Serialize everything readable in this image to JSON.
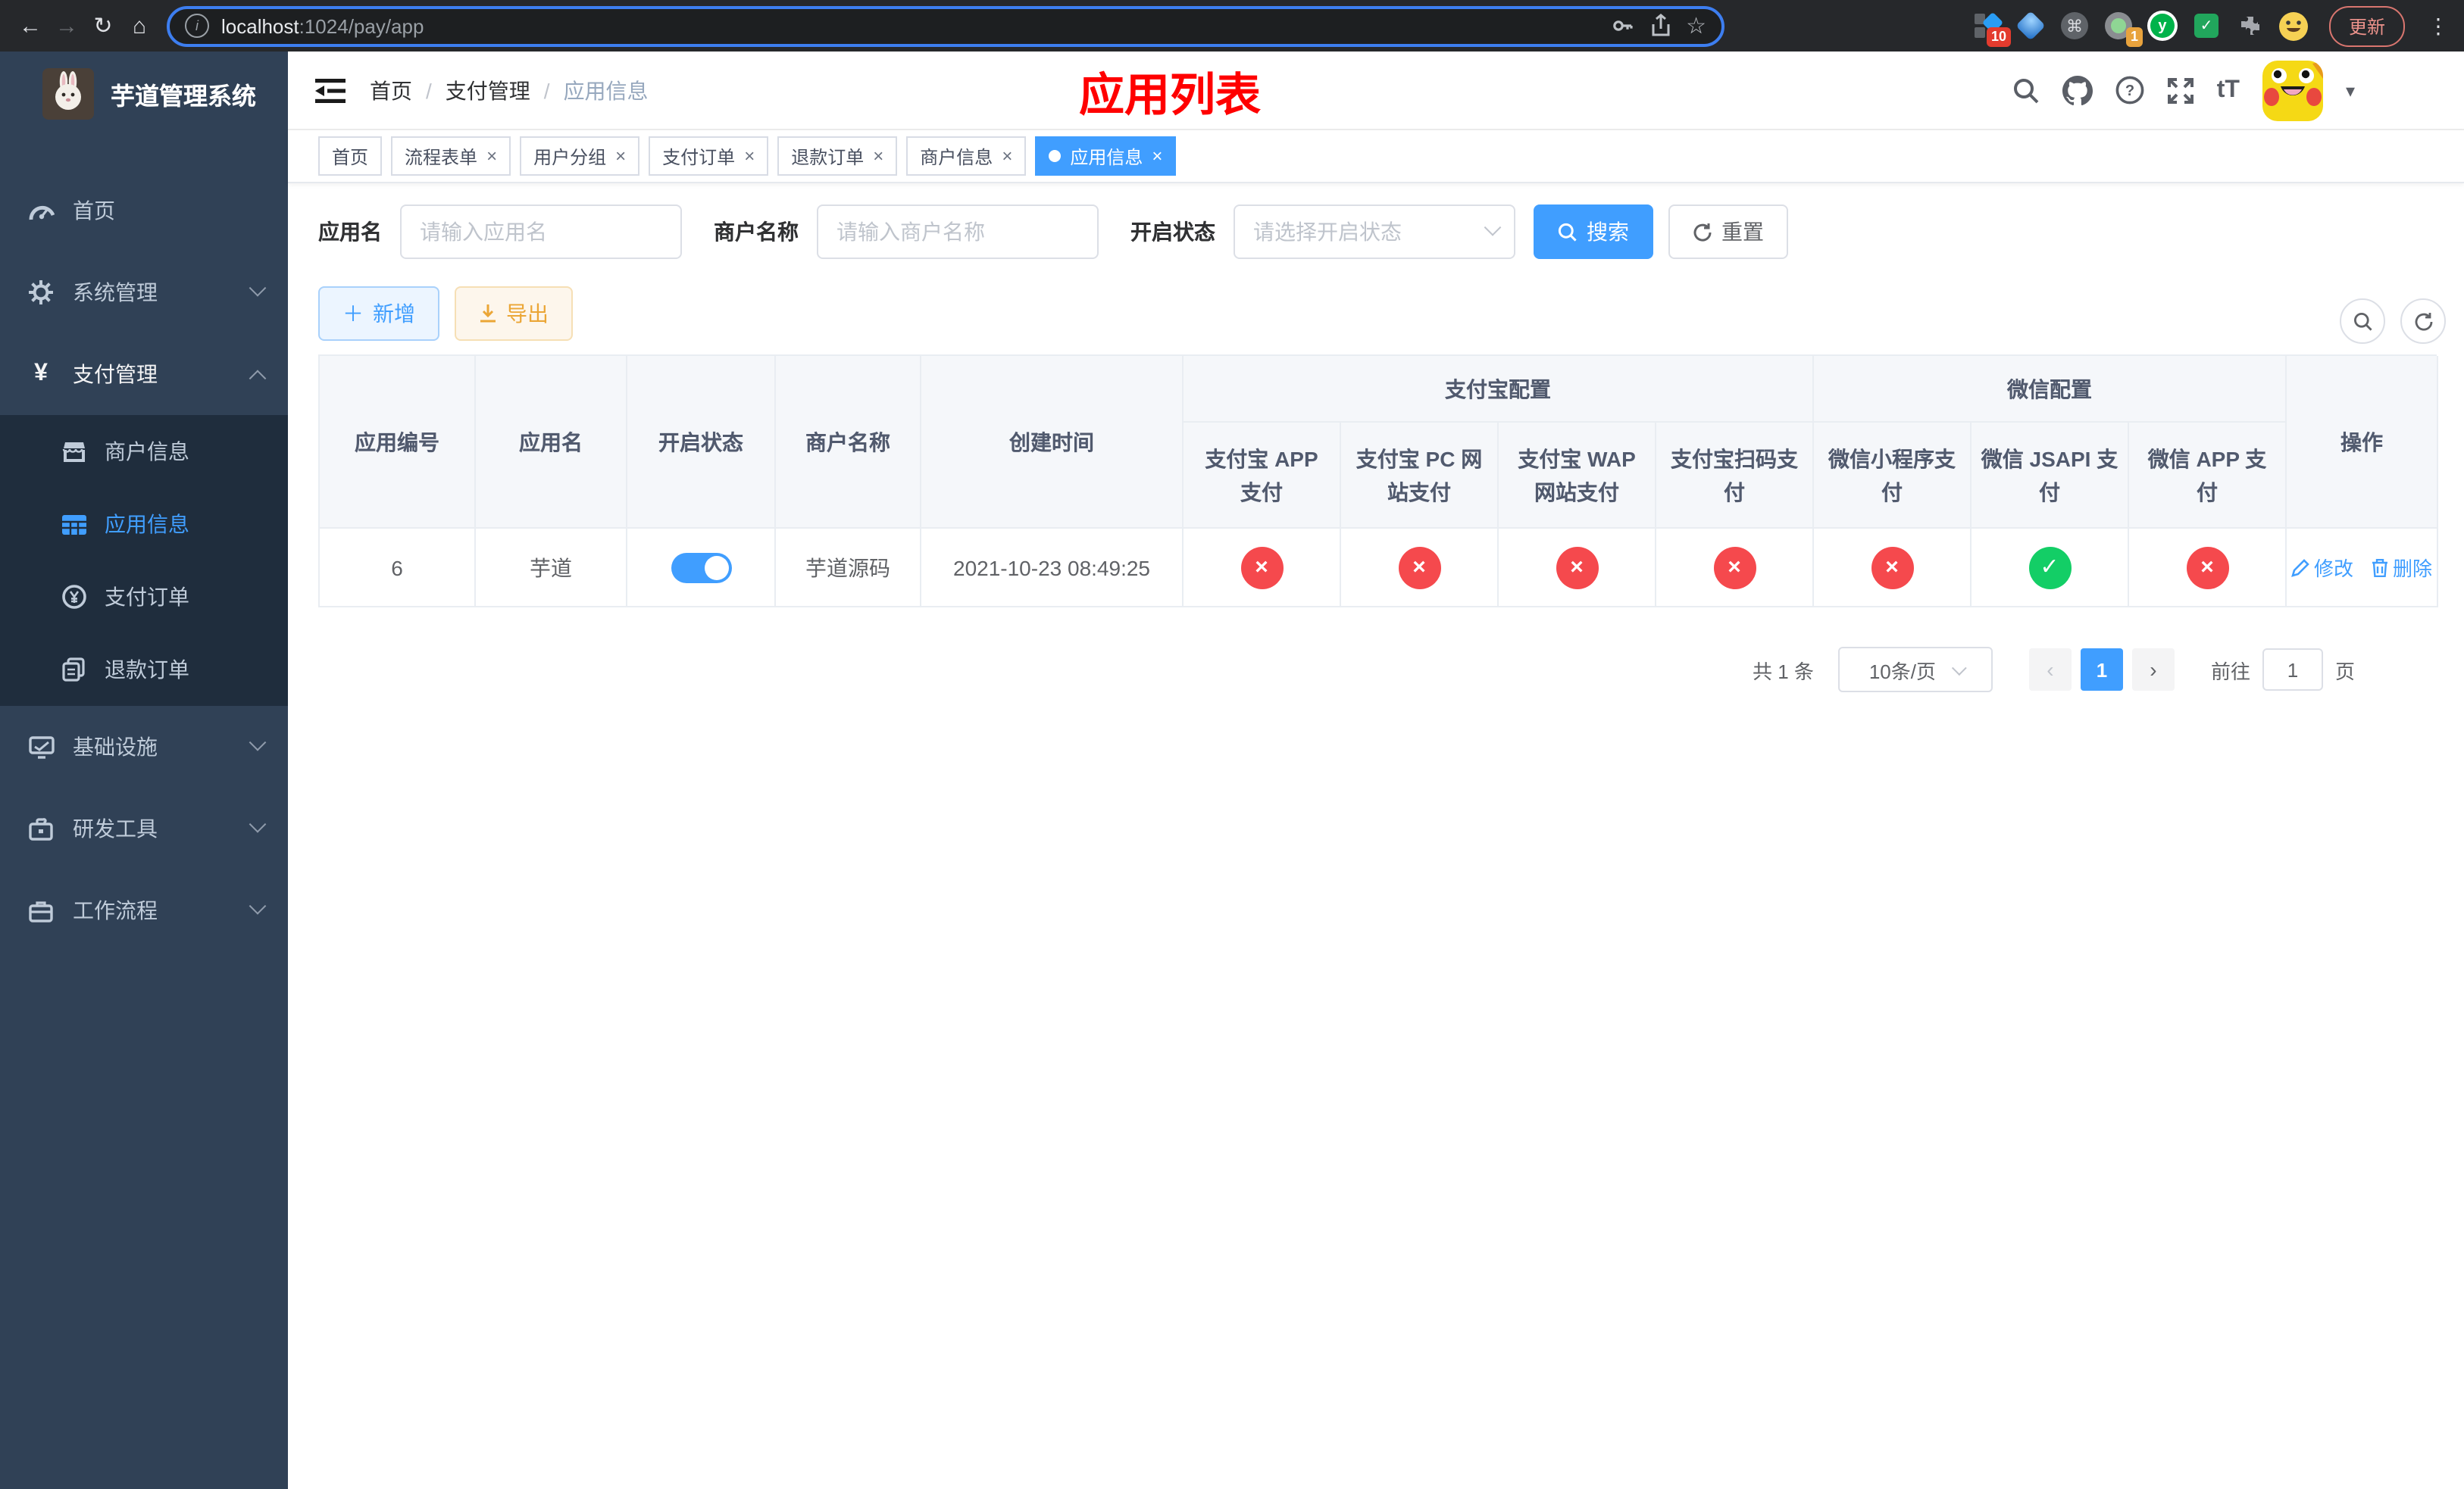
{
  "chrome": {
    "nav": {
      "back": "←",
      "forward": "→",
      "reload": "↻",
      "home": "⌂"
    },
    "url": {
      "host": "localhost",
      "rest": ":1024/pay/app"
    },
    "star": "☆",
    "command_glyph": "⌘",
    "ext_badge_1": "10",
    "ext_badge_2": "1",
    "ext_y_label": "y",
    "update_label": "更新",
    "menu_dots": "⋮"
  },
  "sidebar": {
    "title": "芋道管理系统",
    "items": [
      {
        "label": "首页"
      },
      {
        "label": "系统管理"
      },
      {
        "label": "支付管理"
      },
      {
        "label": "商户信息"
      },
      {
        "label": "应用信息"
      },
      {
        "label": "支付订单"
      },
      {
        "label": "退款订单"
      },
      {
        "label": "基础设施"
      },
      {
        "label": "研发工具"
      },
      {
        "label": "工作流程"
      }
    ],
    "yen_glyph": "¥"
  },
  "header": {
    "breadcrumb": {
      "0": "首页",
      "1": "支付管理",
      "2": "应用信息",
      "sep": "/"
    },
    "page_title": "应用列表",
    "caret": "▾",
    "font_icon": "tT"
  },
  "tabs": [
    {
      "label": "首页"
    },
    {
      "label": "流程表单",
      "close": "×"
    },
    {
      "label": "用户分组",
      "close": "×"
    },
    {
      "label": "支付订单",
      "close": "×"
    },
    {
      "label": "退款订单",
      "close": "×"
    },
    {
      "label": "商户信息",
      "close": "×"
    },
    {
      "label": "应用信息",
      "close": "×",
      "active": true
    }
  ],
  "filters": {
    "app_name": {
      "label": "应用名",
      "placeholder": "请输入应用名",
      "value": ""
    },
    "merchant": {
      "label": "商户名称",
      "placeholder": "请输入商户名称",
      "value": ""
    },
    "status": {
      "label": "开启状态",
      "placeholder": "请选择开启状态"
    },
    "search_label": "搜索",
    "reset_label": "重置"
  },
  "toolbar": {
    "add_label": "新增",
    "add_plus": "＋",
    "export_label": "导出"
  },
  "table": {
    "groups": {
      "alipay": "支付宝配置",
      "wechat": "微信配置"
    },
    "columns": {
      "id": "应用编号",
      "name": "应用名",
      "status": "开启状态",
      "merchant": "商户名称",
      "created": "创建时间",
      "alipay_app": "支付宝 APP 支付",
      "alipay_pc": "支付宝 PC 网站支付",
      "alipay_wap": "支付宝 WAP 网站支付",
      "alipay_qr": "支付宝扫码支付",
      "wx_lite": "微信小程序支付",
      "wx_jsapi": "微信 JSAPI 支付",
      "wx_app": "微信 APP 支付",
      "ops": "操作"
    },
    "row": {
      "id": "6",
      "name": "芋道",
      "enabled": true,
      "merchant": "芋道源码",
      "created": "2021-10-23 08:49:25",
      "alipay_app": "disabled",
      "alipay_pc": "disabled",
      "alipay_wap": "disabled",
      "alipay_qr": "disabled",
      "wx_lite": "disabled",
      "wx_jsapi": "enabled",
      "wx_app": "disabled",
      "edit_label": "修改",
      "delete_label": "删除"
    }
  },
  "pagination": {
    "total": "共 1 条",
    "page_size": "10条/页",
    "prev": "‹",
    "next": "›",
    "current": "1",
    "goto_label": "前往",
    "goto_value": "1",
    "page_suffix": "页"
  },
  "colors": {
    "accent": "#409eff",
    "sidebar_bg": "#304156",
    "submenu_bg": "#1f2d3d",
    "danger_circle": "#f5494d",
    "success_circle": "#13ce66",
    "title_red": "#ff0000"
  }
}
